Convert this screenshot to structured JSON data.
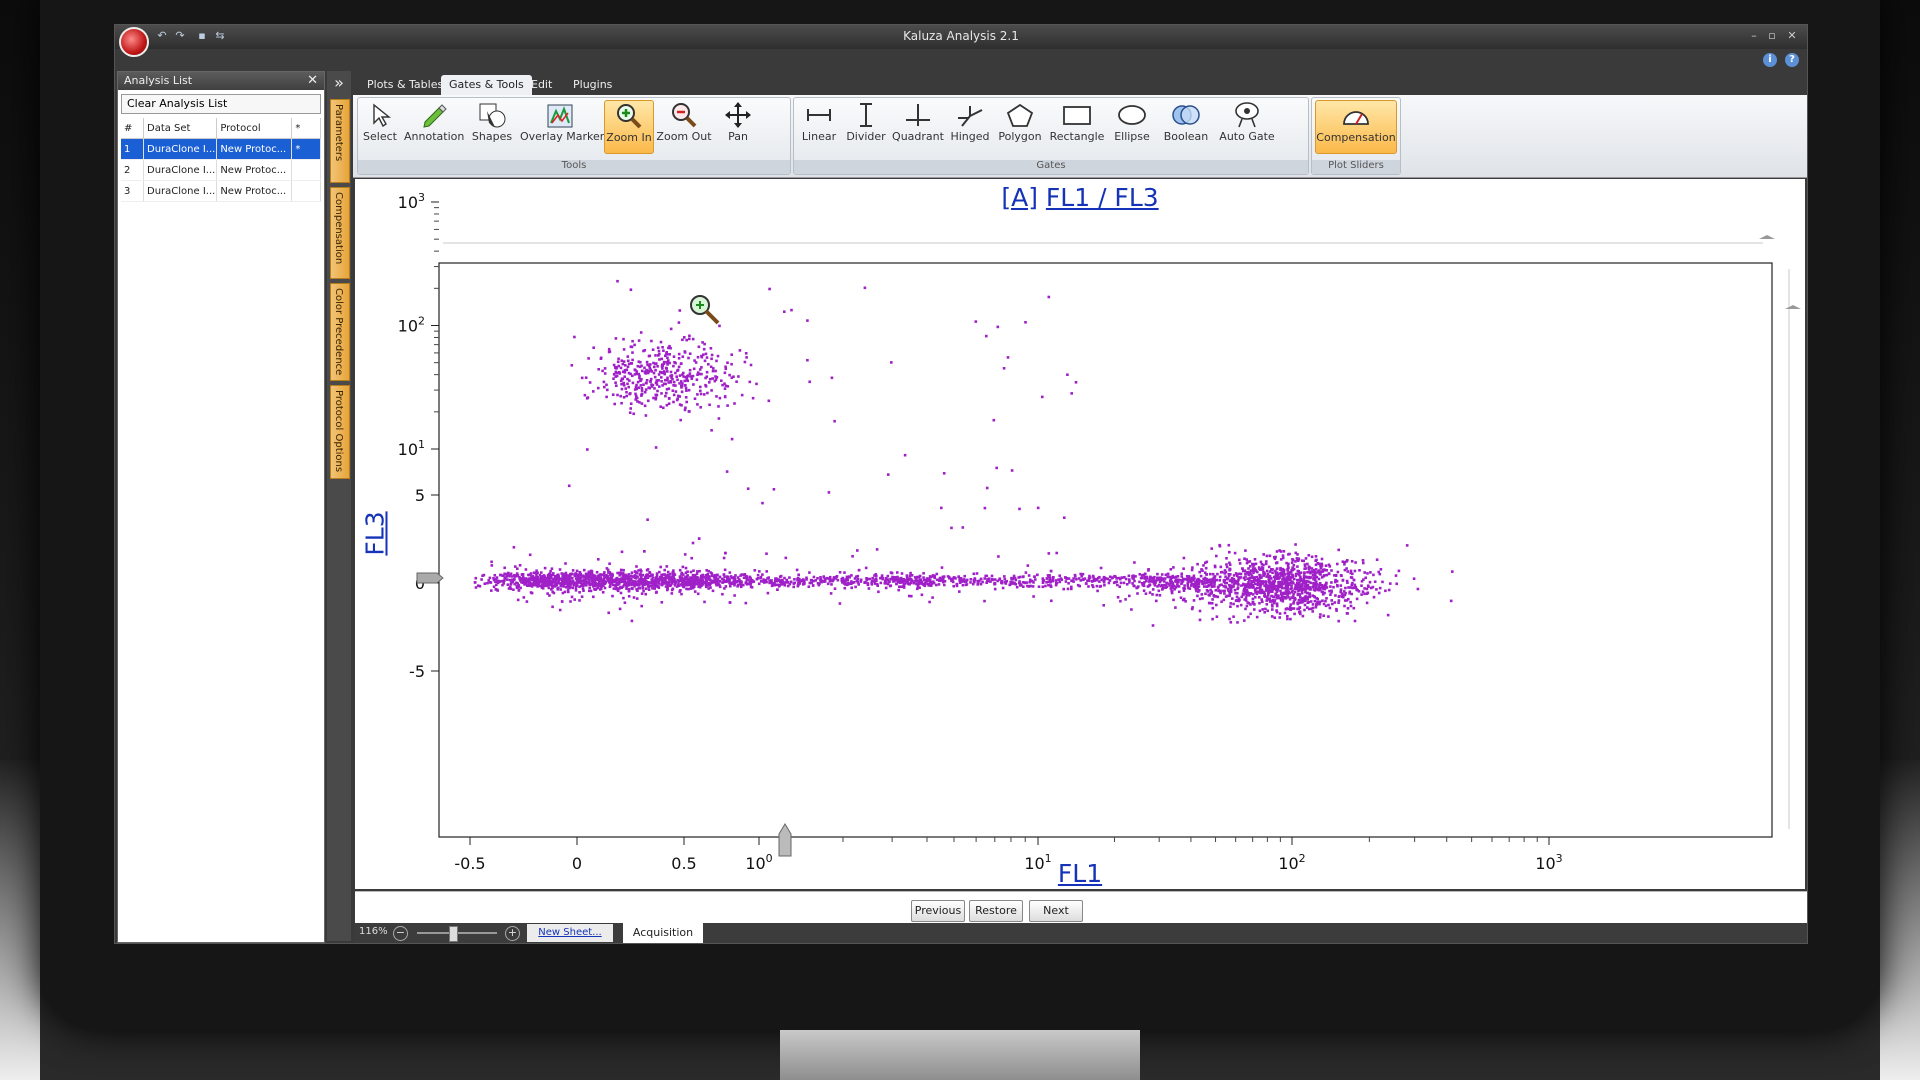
{
  "window": {
    "title": "Kaluza Analysis 2.1"
  },
  "analysis_list": {
    "title": "Analysis List",
    "clear_label": "Clear Analysis List",
    "columns": [
      "#",
      "Data Set",
      "Protocol",
      "*"
    ],
    "rows": [
      {
        "num": "1",
        "data_set": "DuraClone I...",
        "protocol": "New Protoc...",
        "flag": "*",
        "selected": true
      },
      {
        "num": "2",
        "data_set": "DuraClone I...",
        "protocol": "New Protoc...",
        "flag": "",
        "selected": false
      },
      {
        "num": "3",
        "data_set": "DuraClone I...",
        "protocol": "New Protoc...",
        "flag": "",
        "selected": false
      }
    ]
  },
  "side_tabs": [
    "Parameters",
    "Compensation",
    "Color Precedence",
    "Protocol Options"
  ],
  "ribbon": {
    "tabs": [
      "Plots & Tables",
      "Gates & Tools",
      "Edit",
      "Plugins"
    ],
    "active_tab": "Gates & Tools",
    "groups": {
      "tools": "Tools",
      "gates": "Gates",
      "plot_sliders": "Plot Sliders"
    },
    "tools": [
      "Select",
      "Annotation",
      "Shapes",
      "Overlay Marker",
      "Zoom In",
      "Zoom Out",
      "Pan"
    ],
    "gates": [
      "Linear",
      "Divider",
      "Quadrant",
      "Hinged",
      "Polygon",
      "Rectangle",
      "Ellipse",
      "Boolean",
      "Auto Gate"
    ],
    "sliders": [
      "Compensation"
    ],
    "active_tool": "Zoom In",
    "accent": "#fbb94a"
  },
  "plot": {
    "title_prefix": "[A]",
    "title_main": "FL1 / FL3",
    "x_axis_label": "FL1",
    "y_axis_label": "FL3"
  },
  "chart_data": {
    "type": "scatter",
    "title": "[A] FL1 / FL3",
    "xlabel": "FL1",
    "ylabel": "FL3",
    "x_scale": "logicle",
    "y_scale": "logicle",
    "x_ticks": [
      "-0.5",
      "0",
      "0.5",
      "10^0",
      "10^1",
      "10^2",
      "10^3"
    ],
    "y_ticks": [
      "-5",
      "0",
      "5",
      "10^1",
      "10^2",
      "10^3"
    ],
    "point_color": "#a020c8",
    "populations": [
      {
        "name": "",
        "x_center": 0.45,
        "y_center": 0.2,
        "shape": "horizontal band",
        "x_range": [
          -0.55,
          3
        ],
        "y_range": [
          -2,
          3
        ]
      },
      {
        "name": "",
        "x_center": 90,
        "y_center": 0,
        "shape": "cluster",
        "x_range": [
          30,
          300
        ],
        "y_range": [
          -3,
          3
        ]
      },
      {
        "name": "",
        "x_center": 0.4,
        "y_center": 40,
        "shape": "cluster",
        "x_range": [
          0.05,
          0.9
        ],
        "y_range": [
          9,
          150
        ]
      }
    ]
  },
  "nav": {
    "previous": "Previous",
    "restore": "Restore",
    "next": "Next"
  },
  "status": {
    "zoom": "116%",
    "new_sheet": "New Sheet...",
    "sheet_tab": "Acquisition"
  }
}
